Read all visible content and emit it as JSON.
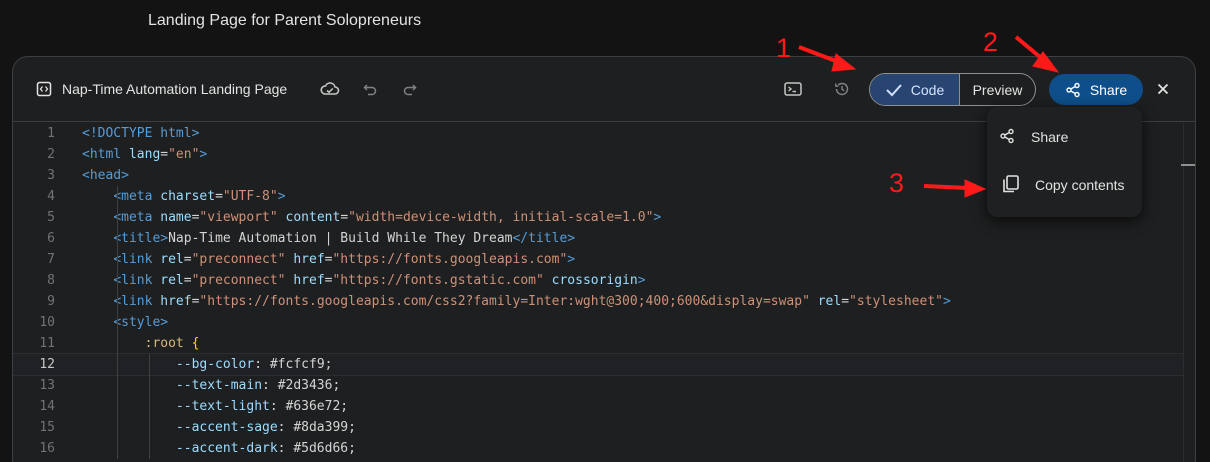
{
  "page_title": "Landing Page for Parent Solopreneurs",
  "toolbar": {
    "file_title": "Nap-Time Automation Landing Page",
    "code_label": "Code",
    "preview_label": "Preview",
    "share_label": "Share",
    "icons": [
      "code-file-icon",
      "cloud-sync-icon",
      "undo-icon",
      "redo-icon",
      "terminal-icon",
      "history-icon",
      "check-icon",
      "share-icon",
      "close-icon"
    ]
  },
  "share_menu": {
    "items": [
      {
        "label": "Share",
        "icon": "share-icon"
      },
      {
        "label": "Copy contents",
        "icon": "copy-icon"
      }
    ]
  },
  "annotations": [
    "1",
    "2",
    "3"
  ],
  "editor": {
    "current_line": 12,
    "lines": [
      {
        "n": "1",
        "tokens": [
          [
            "t-tag",
            "<!DOCTYPE html>"
          ]
        ]
      },
      {
        "n": "2",
        "tokens": [
          [
            "t-tag",
            "<html "
          ],
          [
            "t-attr",
            "lang"
          ],
          [
            "",
            "="
          ],
          [
            "t-str",
            "\"en\""
          ],
          [
            "t-tag",
            ">"
          ]
        ]
      },
      {
        "n": "3",
        "tokens": [
          [
            "t-tag",
            "<head>"
          ]
        ]
      },
      {
        "n": "4",
        "tokens": [
          [
            "",
            "    "
          ],
          [
            "t-tag",
            "<meta "
          ],
          [
            "t-attr",
            "charset"
          ],
          [
            "",
            "="
          ],
          [
            "t-str",
            "\"UTF-8\""
          ],
          [
            "t-tag",
            ">"
          ]
        ]
      },
      {
        "n": "5",
        "tokens": [
          [
            "",
            "    "
          ],
          [
            "t-tag",
            "<meta "
          ],
          [
            "t-attr",
            "name"
          ],
          [
            "",
            "="
          ],
          [
            "t-str",
            "\"viewport\""
          ],
          [
            "",
            " "
          ],
          [
            "t-attr",
            "content"
          ],
          [
            "",
            "="
          ],
          [
            "t-str",
            "\"width=device-width, initial-scale=1.0\""
          ],
          [
            "t-tag",
            ">"
          ]
        ]
      },
      {
        "n": "6",
        "tokens": [
          [
            "",
            "    "
          ],
          [
            "t-tag",
            "<title>"
          ],
          [
            "",
            "Nap-Time Automation | Build While They Dream"
          ],
          [
            "t-tag",
            "</title>"
          ]
        ]
      },
      {
        "n": "7",
        "tokens": [
          [
            "",
            "    "
          ],
          [
            "t-tag",
            "<link "
          ],
          [
            "t-attr",
            "rel"
          ],
          [
            "",
            "="
          ],
          [
            "t-str",
            "\"preconnect\""
          ],
          [
            "",
            " "
          ],
          [
            "t-attr",
            "href"
          ],
          [
            "",
            "="
          ],
          [
            "t-str",
            "\"https://fonts.googleapis.com\""
          ],
          [
            "t-tag",
            ">"
          ]
        ]
      },
      {
        "n": "8",
        "tokens": [
          [
            "",
            "    "
          ],
          [
            "t-tag",
            "<link "
          ],
          [
            "t-attr",
            "rel"
          ],
          [
            "",
            "="
          ],
          [
            "t-str",
            "\"preconnect\""
          ],
          [
            "",
            " "
          ],
          [
            "t-attr",
            "href"
          ],
          [
            "",
            "="
          ],
          [
            "t-str",
            "\"https://fonts.gstatic.com\""
          ],
          [
            "",
            " "
          ],
          [
            "t-attr",
            "crossorigin"
          ],
          [
            "t-tag",
            ">"
          ]
        ]
      },
      {
        "n": "9",
        "tokens": [
          [
            "",
            "    "
          ],
          [
            "t-tag",
            "<link "
          ],
          [
            "t-attr",
            "href"
          ],
          [
            "",
            "="
          ],
          [
            "t-str",
            "\"https://fonts.googleapis.com/css2?family=Inter:wght@300;400;600&display=swap\""
          ],
          [
            "",
            " "
          ],
          [
            "t-attr",
            "rel"
          ],
          [
            "",
            "="
          ],
          [
            "t-str",
            "\"stylesheet\""
          ],
          [
            "t-tag",
            ">"
          ]
        ]
      },
      {
        "n": "10",
        "tokens": [
          [
            "",
            "    "
          ],
          [
            "t-tag",
            "<style>"
          ]
        ]
      },
      {
        "n": "11",
        "tokens": [
          [
            "",
            "        "
          ],
          [
            "t-sel",
            ":root"
          ],
          [
            "",
            " "
          ],
          [
            "t-brace",
            "{"
          ]
        ]
      },
      {
        "n": "12",
        "tokens": [
          [
            "",
            "            "
          ],
          [
            "t-prop",
            "--bg-color"
          ],
          [
            "",
            ": #fcfcf9;"
          ]
        ]
      },
      {
        "n": "13",
        "tokens": [
          [
            "",
            "            "
          ],
          [
            "t-prop",
            "--text-main"
          ],
          [
            "",
            ": #2d3436;"
          ]
        ]
      },
      {
        "n": "14",
        "tokens": [
          [
            "",
            "            "
          ],
          [
            "t-prop",
            "--text-light"
          ],
          [
            "",
            ": #636e72;"
          ]
        ]
      },
      {
        "n": "15",
        "tokens": [
          [
            "",
            "            "
          ],
          [
            "t-prop",
            "--accent-sage"
          ],
          [
            "",
            ": #8da399;"
          ]
        ]
      },
      {
        "n": "16",
        "tokens": [
          [
            "",
            "            "
          ],
          [
            "t-prop",
            "--accent-dark"
          ],
          [
            "",
            ": #5d6d66;"
          ]
        ]
      }
    ]
  },
  "colors": {
    "accent": "#0e4f8b",
    "code_selected": "#284572",
    "annotation": "#ff1a1a"
  }
}
